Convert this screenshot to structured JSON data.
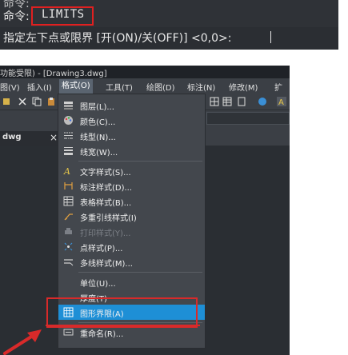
{
  "command_line": {
    "prev_line": "命令:",
    "prompt": "命令:",
    "command": "LIMITS",
    "hint": "指定左下点或限界 [开(ON)/关(OFF)] <0,0>:"
  },
  "window": {
    "title": "功能受限) - [Drawing3.dwg]",
    "tab_label": "dwg",
    "tab_close": "×"
  },
  "menubar": {
    "items": [
      {
        "label": "图(V)"
      },
      {
        "label": "插入(I)"
      },
      {
        "label": "格式(O)"
      },
      {
        "label": "工具(T)"
      },
      {
        "label": "绘图(D)"
      },
      {
        "label": "标注(N)"
      },
      {
        "label": "修改(M)"
      },
      {
        "label": "扩"
      }
    ]
  },
  "format_menu": {
    "items": [
      {
        "label": "图层(L)...",
        "icon": "layers-icon"
      },
      {
        "label": "颜色(C)...",
        "icon": "color-palette-icon"
      },
      {
        "label": "线型(N)...",
        "icon": "linetype-icon"
      },
      {
        "label": "线宽(W)...",
        "icon": "lineweight-icon"
      },
      {
        "label": "文字样式(S)...",
        "icon": "text-style-icon"
      },
      {
        "label": "标注样式(D)...",
        "icon": "dim-style-icon"
      },
      {
        "label": "表格样式(B)...",
        "icon": "table-style-icon"
      },
      {
        "label": "多重引线样式(I)",
        "icon": "mleader-style-icon"
      },
      {
        "label": "打印样式(Y)...",
        "icon": "plot-style-icon",
        "disabled": true
      },
      {
        "label": "点样式(P)...",
        "icon": "point-style-icon"
      },
      {
        "label": "多线样式(M)...",
        "icon": "mline-style-icon"
      },
      {
        "label": "单位(U)...",
        "icon": "units-icon"
      },
      {
        "label": "厚度(T)",
        "icon": "thickness-icon"
      },
      {
        "label": "图形界限(A)",
        "icon": "limits-icon",
        "selected": true
      },
      {
        "label": "重命名(R)...",
        "icon": "rename-icon"
      }
    ]
  },
  "colors": {
    "highlight": "#1e8fd6",
    "annotation": "#d82a2a",
    "menu_bg": "#43474d"
  }
}
